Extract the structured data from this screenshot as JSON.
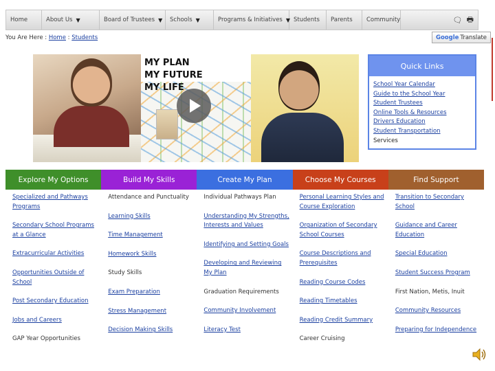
{
  "nav": {
    "items": [
      {
        "label": "Home",
        "dropdown": false
      },
      {
        "label": "About Us",
        "dropdown": true
      },
      {
        "label": "Board of Trustees",
        "dropdown": true
      },
      {
        "label": "Schools",
        "dropdown": true
      },
      {
        "label": "Programs & Initiatives",
        "dropdown": true
      },
      {
        "label": "Students",
        "dropdown": false
      },
      {
        "label": "Parents",
        "dropdown": false
      },
      {
        "label": "Community",
        "dropdown": false
      }
    ],
    "icons": [
      "speech-bubble-icon",
      "print-icon"
    ]
  },
  "breadcrumb": {
    "prefix": "You Are Here :",
    "home": "Home",
    "separator": ":",
    "current": "Students"
  },
  "translate": {
    "brand": "Google",
    "label": "Translate"
  },
  "hero": {
    "lines": [
      "MY PLAN",
      "MY FUTURE",
      "MY LIFE"
    ]
  },
  "quick_links": {
    "title": "Quick Links",
    "items": [
      {
        "label": "School Year Calendar",
        "underline": true
      },
      {
        "label": "Guide to the School Year",
        "underline": true
      },
      {
        "label": "Student Trustees",
        "underline": true
      },
      {
        "label": "Online Tools & Resources",
        "underline": true
      },
      {
        "label": "Drivers Education",
        "underline": true
      },
      {
        "label": "Student Transportation",
        "underline": true
      },
      {
        "label": "Services",
        "underline": false
      }
    ]
  },
  "categories": [
    {
      "label": "Explore My Options",
      "color": "#3f8f2a"
    },
    {
      "label": "Build My Skills",
      "color": "#9a22d6"
    },
    {
      "label": "Create My Plan",
      "color": "#3b6fe0"
    },
    {
      "label": "Choose My Courses",
      "color": "#c8401a"
    },
    {
      "label": "Find Support",
      "color": "#a0602e"
    }
  ],
  "columns": [
    [
      {
        "label": "Specialized and Pathways Programs",
        "link": true
      },
      {
        "label": "Secondary School Programs at a Glance",
        "link": true
      },
      {
        "label": "Extracurricular Activities",
        "link": true
      },
      {
        "label": "Opportunities Outside of School",
        "link": true
      },
      {
        "label": "Post Secondary Education",
        "link": true
      },
      {
        "label": "Jobs and Careers",
        "link": true
      },
      {
        "label": "GAP Year Opportunities",
        "link": false
      }
    ],
    [
      {
        "label": "Attendance and Punctuality",
        "link": false
      },
      {
        "label": "Learning Skills",
        "link": true
      },
      {
        "label": "Time Management",
        "link": true
      },
      {
        "label": "Homework Skills",
        "link": true
      },
      {
        "label": "Study Skills",
        "link": false
      },
      {
        "label": "Exam Preparation",
        "link": true
      },
      {
        "label": "Stress Management",
        "link": true
      },
      {
        "label": "Decision Making Skills",
        "link": true
      }
    ],
    [
      {
        "label": "Individual Pathways Plan",
        "link": false
      },
      {
        "label": "Understanding My Strengths, Interests and Values",
        "link": true
      },
      {
        "label": "Identifying and Setting Goals",
        "link": true
      },
      {
        "label": "Developing and Reviewing My Plan",
        "link": true
      },
      {
        "label": "Graduation Requirements",
        "link": false
      },
      {
        "label": "Community Involvement",
        "link": true
      },
      {
        "label": "Literacy Test",
        "link": true
      }
    ],
    [
      {
        "label": "Personal Learning Styles and Course Exploration",
        "link": true
      },
      {
        "label": "Organization of Secondary School Courses",
        "link": true
      },
      {
        "label": "Course Descriptions and Prerequisites",
        "link": true
      },
      {
        "label": "Reading Course Codes",
        "link": true
      },
      {
        "label": "Reading Timetables",
        "link": true
      },
      {
        "label": "Reading Credit Summary",
        "link": true
      },
      {
        "label": "Career Cruising",
        "link": false
      }
    ],
    [
      {
        "label": "Transition to Secondary School",
        "link": true
      },
      {
        "label": "Guidance and Career Education",
        "link": true
      },
      {
        "label": "Special Education",
        "link": true
      },
      {
        "label": "Student Success Program",
        "link": true
      },
      {
        "label": "First Nation, Metis, Inuit",
        "link": false
      },
      {
        "label": "Community Resources",
        "link": true
      },
      {
        "label": "Preparing for Independence",
        "link": true
      }
    ]
  ]
}
